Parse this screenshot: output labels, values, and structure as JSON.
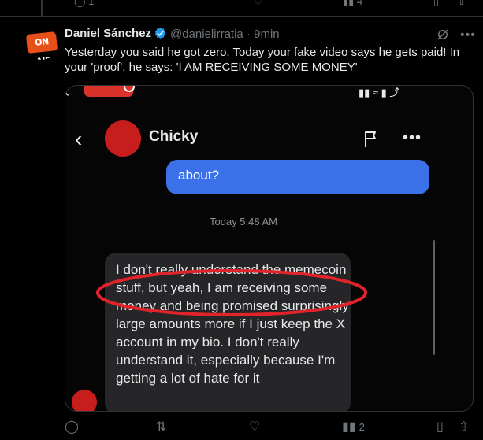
{
  "prev_tweet": {
    "actions": [
      {
        "name": "reply-icon",
        "count": "1"
      },
      {
        "name": "retweet-icon",
        "count": ""
      },
      {
        "name": "like-icon",
        "count": ""
      },
      {
        "name": "views-icon",
        "count": "4"
      },
      {
        "name": "bookmark-icon",
        "count": ""
      },
      {
        "name": "share-icon",
        "count": ""
      }
    ]
  },
  "tweet": {
    "author_name": "Daniel Sánchez",
    "handle": "@danielirratia",
    "separator": "·",
    "time": "9min",
    "avatar_text": "ON AIR",
    "text": "Yesterday you said he got zero. Today your fake video says he gets paid! In your 'proof', he says: 'I AM RECEIVING SOME MONEY'",
    "verified_color": "#1d9bf0"
  },
  "media": {
    "contact_name": "Chicky",
    "sent_bubble_text": "about?",
    "timestamp": "Today 5:48 AM",
    "received_message": "I don't really understand the memecoin stuff, but yeah, I am receiving some money and being promised surprisingly large amounts more if I just keep the X account in my bio. I don't really understand it, especially because I'm getting a lot of hate for it",
    "bubble_color": "#3a70e8",
    "highlight_color": "#e0242a"
  },
  "actions": {
    "reply_count": "",
    "retweet_count": "",
    "like_count": "",
    "views_count": "2",
    "bookmark_count": "",
    "share_count": ""
  }
}
